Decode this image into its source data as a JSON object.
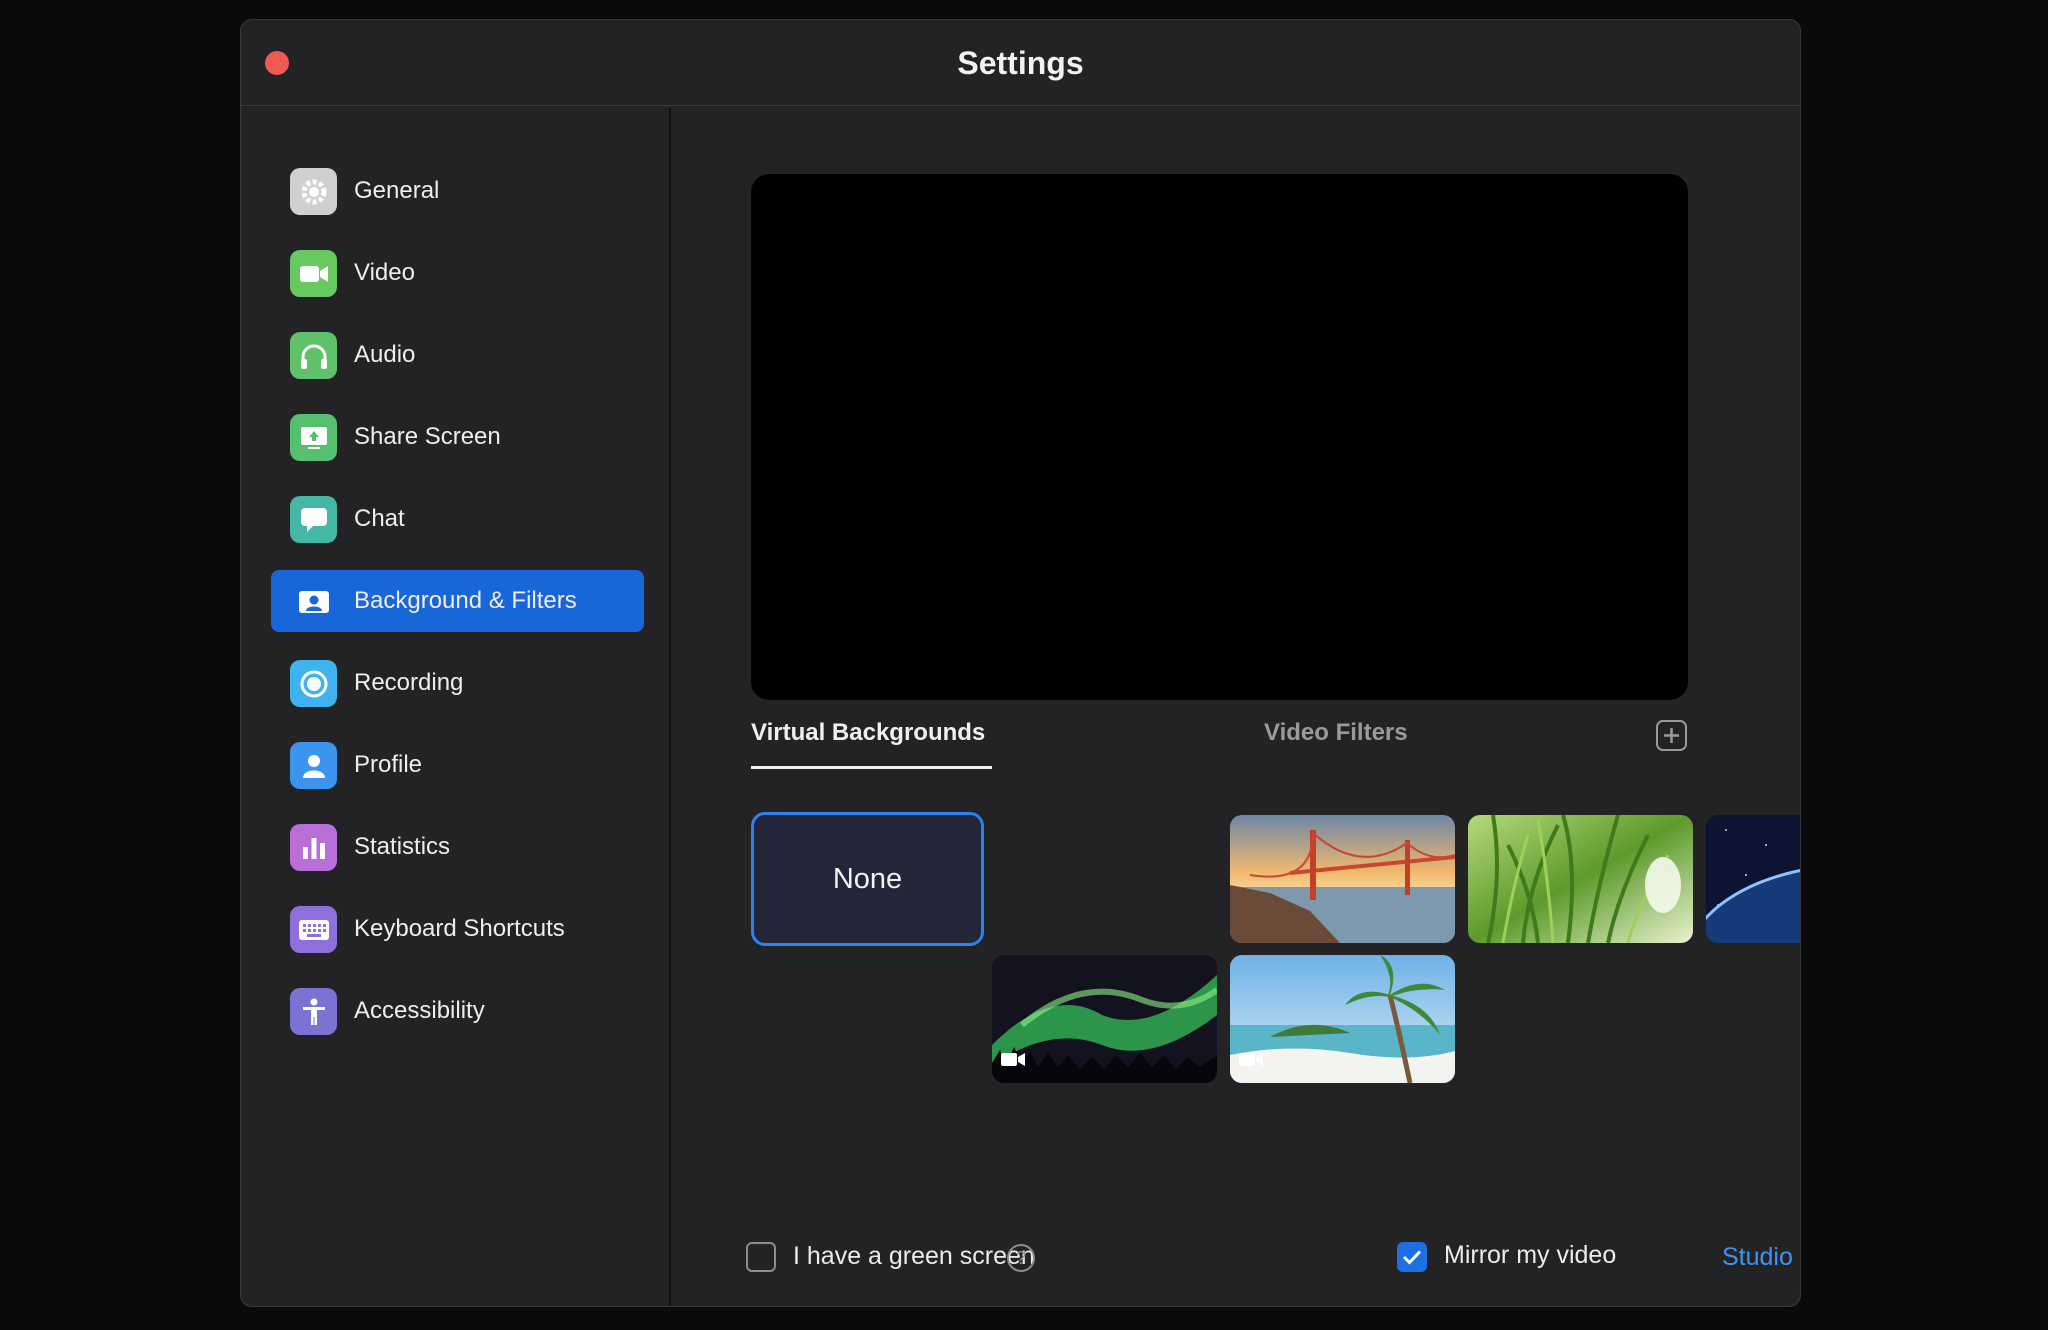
{
  "window": {
    "title": "Settings"
  },
  "sidebar": {
    "items": [
      {
        "label": "General",
        "icon": "gear-icon",
        "color": "#d0d0d2"
      },
      {
        "label": "Video",
        "icon": "video-camera-icon",
        "color": "#67c95f"
      },
      {
        "label": "Audio",
        "icon": "headphones-icon",
        "color": "#5fc26b"
      },
      {
        "label": "Share Screen",
        "icon": "share-screen-icon",
        "color": "#55c06f"
      },
      {
        "label": "Chat",
        "icon": "chat-bubble-icon",
        "color": "#45b8a5"
      },
      {
        "label": "Background & Filters",
        "icon": "background-person-icon",
        "color": "#1966d8",
        "active": true
      },
      {
        "label": "Recording",
        "icon": "record-icon",
        "color": "#3fb3ef"
      },
      {
        "label": "Profile",
        "icon": "profile-icon",
        "color": "#3b95ee"
      },
      {
        "label": "Statistics",
        "icon": "statistics-icon",
        "color": "#b86fd8"
      },
      {
        "label": "Keyboard Shortcuts",
        "icon": "keyboard-icon",
        "color": "#8e70dc"
      },
      {
        "label": "Accessibility",
        "icon": "accessibility-icon",
        "color": "#7b73d4"
      }
    ]
  },
  "tabs": {
    "virtual_backgrounds": "Virtual Backgrounds",
    "video_filters": "Video Filters"
  },
  "backgrounds": {
    "none_label": "None",
    "items": [
      {
        "name": "golden-gate-bridge",
        "video": false
      },
      {
        "name": "grass",
        "video": false
      },
      {
        "name": "earth-from-space",
        "video": false
      },
      {
        "name": "aurora",
        "video": true
      },
      {
        "name": "beach-palm",
        "video": true
      }
    ]
  },
  "options": {
    "green_screen_label": "I have a green screen",
    "green_screen_checked": false,
    "help_glyph": "?",
    "mirror_label": "Mirror my video",
    "mirror_checked": true,
    "studio_effects": "Studio Effects (Beta)"
  }
}
